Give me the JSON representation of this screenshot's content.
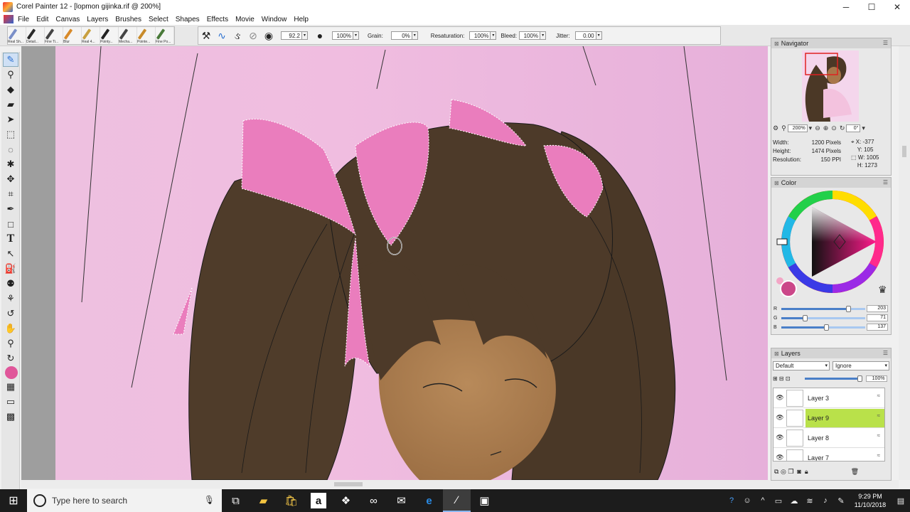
{
  "window": {
    "title": "Corel Painter 12 - [lopmon gijinka.rif @ 200%]",
    "controls": [
      "─",
      "☐",
      "✕"
    ]
  },
  "menu": [
    "File",
    "Edit",
    "Canvas",
    "Layers",
    "Brushes",
    "Select",
    "Shapes",
    "Effects",
    "Movie",
    "Window",
    "Help"
  ],
  "brush_tracker": [
    {
      "label": "Real Sh...",
      "color": "#7a8fc8"
    },
    {
      "label": "Detail...",
      "color": "#2a2a2a"
    },
    {
      "label": "Fine Ti...",
      "color": "#444444"
    },
    {
      "label": "Blur",
      "color": "#d88a2a"
    },
    {
      "label": "Real 4...",
      "color": "#c8a040"
    },
    {
      "label": "Pointy...",
      "color": "#222222"
    },
    {
      "label": "Mecha...",
      "color": "#444444"
    },
    {
      "label": "Pointe...",
      "color": "#c88a2a"
    },
    {
      "label": "Fine Po...",
      "color": "#4a7a3a"
    }
  ],
  "property_bar": {
    "size_value": "92.2",
    "opacity_value": "100%",
    "grain_label": "Grain:",
    "grain_value": "0%",
    "resaturation_label": "Resaturation:",
    "resaturation_value": "100%",
    "bleed_label": "Bleed:",
    "bleed_value": "100%",
    "jitter_label": "Jitter:",
    "jitter_value": "0.00"
  },
  "toolbox": {
    "active_tool": "brush-tool",
    "main_color": "#e0569a",
    "tools": [
      "brush-tool",
      "dropper-tool",
      "eraser-tool",
      "blender-tool",
      "layer-adjuster-tool",
      "rectangular-selection-tool",
      "lasso-tool",
      "magic-wand-tool",
      "transform-tool",
      "crop-tool",
      "pen-tool",
      "rectangle-tool",
      "text-tool",
      "shape-selection-tool",
      "paint-bucket-tool",
      "cloner-tool",
      "rubber-stamp-tool",
      "dodge-tool",
      "burn-tool",
      "grabber-tool",
      "magnifier-tool",
      "rotate-page-tool"
    ]
  },
  "navigator": {
    "title": "Navigator",
    "zoom_value": "200%",
    "rotation_value": "0°",
    "width_label": "Width:",
    "width_value": "1200 Pixels",
    "height_label": "Height:",
    "height_value": "1474 Pixels",
    "resolution_label": "Resolution:",
    "resolution_value": "150 PPI",
    "x_label": "X:",
    "x_value": "-377",
    "y_label": "Y:",
    "y_value": "105",
    "w_label": "W:",
    "w_value": "1005",
    "h_label": "H:",
    "h_value": "1273"
  },
  "color_panel": {
    "title": "Color",
    "current_color": "#cb4789",
    "channels": [
      {
        "label": "R",
        "value": "203",
        "fraction": 0.796
      },
      {
        "label": "G",
        "value": "71",
        "fraction": 0.278
      },
      {
        "label": "B",
        "value": "137",
        "fraction": 0.537
      }
    ]
  },
  "layers_panel": {
    "title": "Layers",
    "composite_method": "Default",
    "preserve_mode": "Ignore",
    "opacity_value": "100%",
    "layers": [
      {
        "name": "Layer 3",
        "selected": false
      },
      {
        "name": "Layer 9",
        "selected": true
      },
      {
        "name": "Layer 8",
        "selected": false
      },
      {
        "name": "Layer 7",
        "selected": false
      }
    ]
  },
  "taskbar": {
    "search_placeholder": "Type here to search",
    "time": "9:29 PM",
    "date": "11/10/2018"
  }
}
